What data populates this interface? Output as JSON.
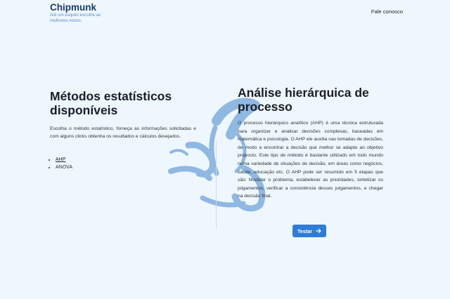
{
  "header": {
    "brand_name": "Chipmunk",
    "tagline": "Até um esquilo escolhe as melhores nozes.",
    "contact_label": "Fale conosco"
  },
  "left": {
    "title": "Métodos estatísticos disponíveis",
    "description": "Escolha o método estatístico, forneça as informações solicitadas e com alguns clicks obtenha os resultados e cálculos desejados.",
    "methods": [
      "AHP",
      "ANOVA"
    ]
  },
  "right": {
    "title": "Análise hierárquica de processo",
    "description": "O processo hierárquico analítico (AHP) é uma técnica estruturada para organizar e analisar decisões complexas, baseadas em matemática e psicologia. O AHP ele auxilia nas tomadas de decisões, de modo a encontrar a decisão que melhor se adapte ao objetivo proposto. Este tipo de método é bastante utilizado em todo mundo numa variedade de situações de decisão, em áreas como negócios, saúde, educação etc. O AHP pode ser resumido em 5 etapas que são: Modelar o problema, estabelecer as prioridades, sintetizar os julgamentos, verificar a consistência desses julgamentos, e chegar na decisão final.",
    "button_label": "Testar"
  },
  "icons": {
    "mascot": "chipmunk-outline-icon",
    "button_arrow": "arrow-right-icon"
  },
  "colors": {
    "background": "#eef7fd",
    "brand": "#1e3a68",
    "tagline": "#5b8ec9",
    "accent": "#2e7cd6",
    "mascot": "#8fb8e2"
  }
}
